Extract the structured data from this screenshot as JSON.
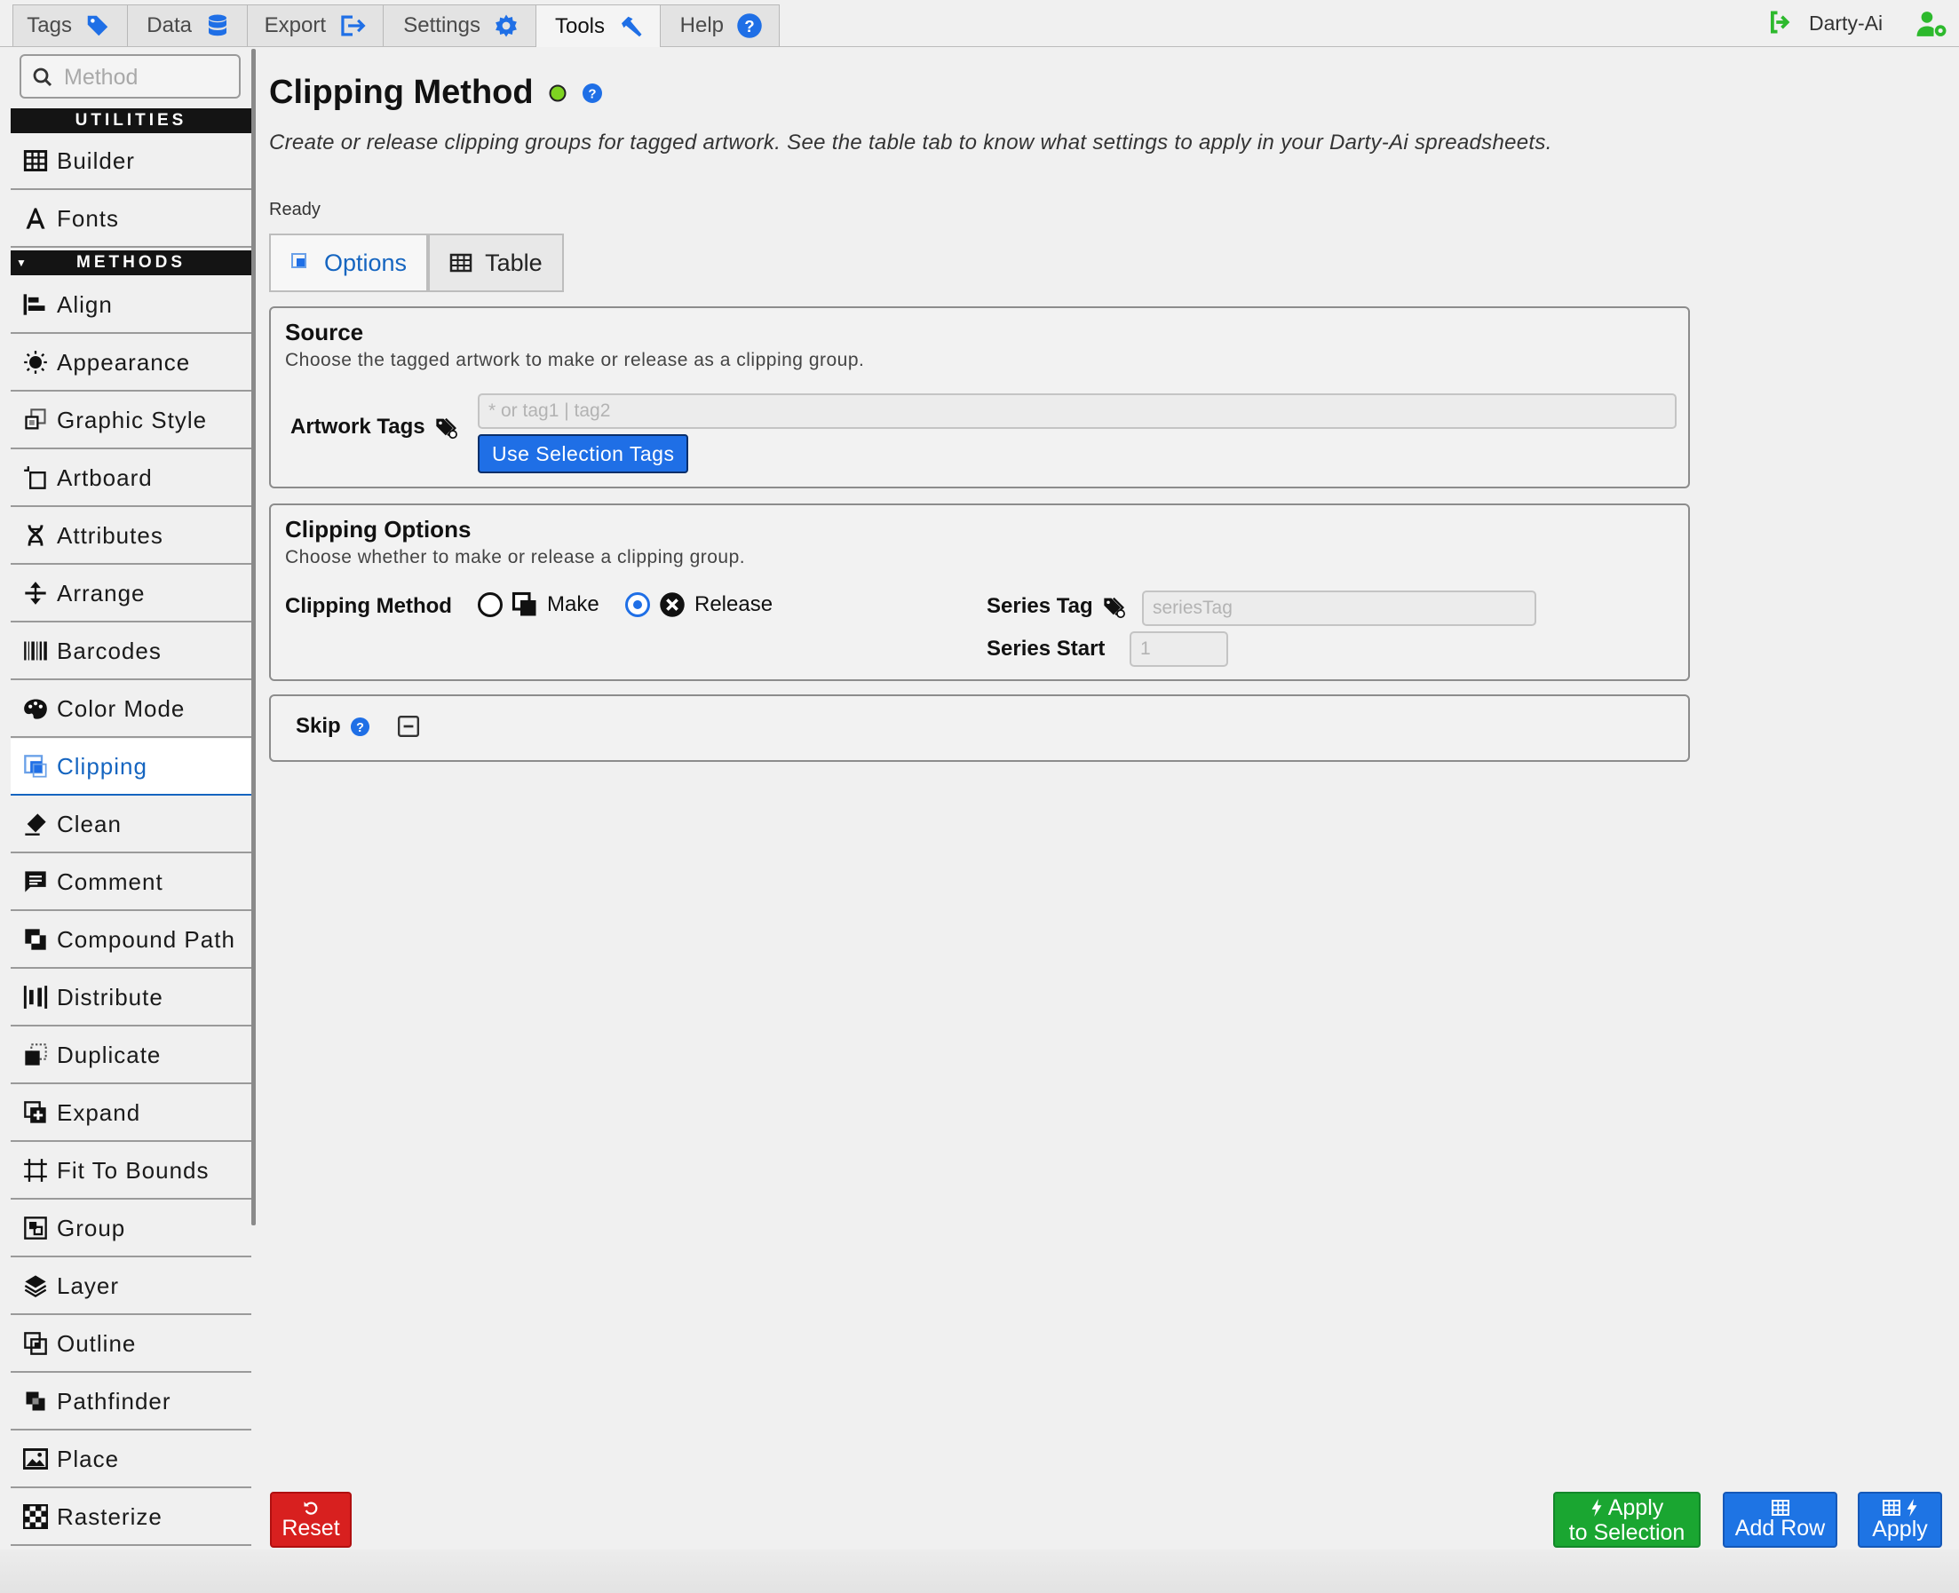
{
  "top_tabs": [
    {
      "label": "Tags",
      "icon": "tag-icon"
    },
    {
      "label": "Data",
      "icon": "database-icon"
    },
    {
      "label": "Export",
      "icon": "export-icon"
    },
    {
      "label": "Settings",
      "icon": "gear-icon"
    },
    {
      "label": "Tools",
      "icon": "hammer-icon",
      "active": true
    },
    {
      "label": "Help",
      "icon": "help-icon"
    }
  ],
  "user": {
    "name": "Darty-Ai"
  },
  "sidebar": {
    "search_placeholder": "Method",
    "utilities_heading": "UTILITIES",
    "methods_heading": "METHODS",
    "utilities": [
      {
        "label": "Builder",
        "icon": "table-icon"
      },
      {
        "label": "Fonts",
        "icon": "font-icon"
      }
    ],
    "methods": [
      {
        "label": "Align",
        "icon": "align-icon"
      },
      {
        "label": "Appearance",
        "icon": "sun-icon"
      },
      {
        "label": "Graphic Style",
        "icon": "graphic-style-icon"
      },
      {
        "label": "Artboard",
        "icon": "artboard-icon"
      },
      {
        "label": "Attributes",
        "icon": "dna-icon"
      },
      {
        "label": "Arrange",
        "icon": "arrange-icon"
      },
      {
        "label": "Barcodes",
        "icon": "barcode-icon"
      },
      {
        "label": "Color Mode",
        "icon": "palette-icon"
      },
      {
        "label": "Clipping",
        "icon": "clipping-icon",
        "active": true
      },
      {
        "label": "Clean",
        "icon": "eraser-icon"
      },
      {
        "label": "Comment",
        "icon": "comment-icon"
      },
      {
        "label": "Compound Path",
        "icon": "compound-path-icon"
      },
      {
        "label": "Distribute",
        "icon": "distribute-icon"
      },
      {
        "label": "Duplicate",
        "icon": "duplicate-icon"
      },
      {
        "label": "Expand",
        "icon": "expand-icon"
      },
      {
        "label": "Fit To Bounds",
        "icon": "fit-bounds-icon"
      },
      {
        "label": "Group",
        "icon": "group-icon"
      },
      {
        "label": "Layer",
        "icon": "layer-icon"
      },
      {
        "label": "Outline",
        "icon": "outline-icon"
      },
      {
        "label": "Pathfinder",
        "icon": "pathfinder-icon"
      },
      {
        "label": "Place",
        "icon": "image-icon"
      },
      {
        "label": "Rasterize",
        "icon": "checker-icon"
      }
    ]
  },
  "main": {
    "title": "Clipping Method",
    "status_dot_color": "#7ed321",
    "description": "Create or release clipping groups for tagged artwork. See the table tab to know what settings to apply in your Darty-Ai spreadsheets.",
    "status": "Ready",
    "subtabs": [
      {
        "label": "Options",
        "active": true
      },
      {
        "label": "Table"
      }
    ],
    "source": {
      "title": "Source",
      "subtitle": "Choose the tagged artwork to make or release as a clipping group.",
      "artwork_tags_label": "Artwork Tags",
      "artwork_tags_placeholder": "* or tag1 | tag2",
      "use_selection_button": "Use Selection Tags"
    },
    "clipping_options": {
      "title": "Clipping Options",
      "subtitle": "Choose whether to make or release a clipping group.",
      "method_label": "Clipping Method",
      "make_label": "Make",
      "release_label": "Release",
      "selected": "Release",
      "series_tag_label": "Series Tag",
      "series_tag_placeholder": "seriesTag",
      "series_start_label": "Series Start",
      "series_start_placeholder": "1"
    },
    "skip": {
      "label": "Skip"
    }
  },
  "footer": {
    "reset_label": "Reset",
    "apply_selection_line1": "Apply",
    "apply_selection_line2": "to Selection",
    "add_row_label": "Add Row",
    "apply_label": "Apply"
  },
  "colors": {
    "accent_blue": "#1f6fe6",
    "active_text": "#1565c0",
    "reset_red": "#d8201f",
    "apply_green": "#1aa631",
    "add_row_blue": "#1e74e4",
    "user_green": "#2db92d"
  }
}
